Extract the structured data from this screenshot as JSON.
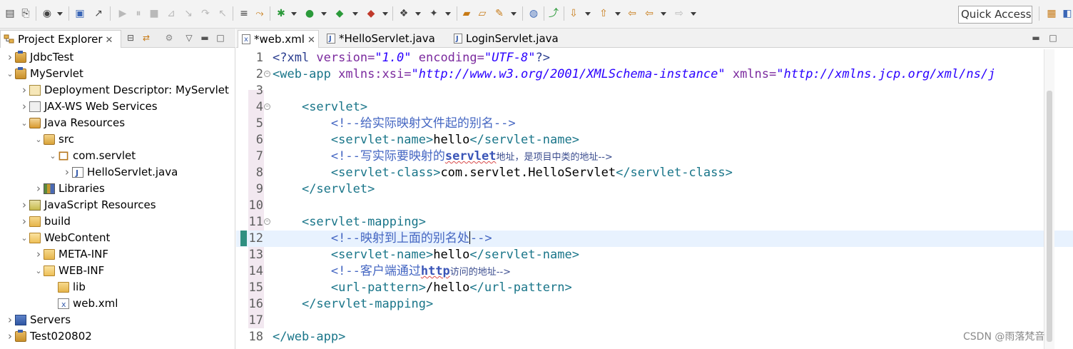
{
  "toolbar": {
    "quick_access": "Quick Access",
    "icons": [
      "new-icon",
      "open-icon",
      "run-config-icon",
      "console-icon",
      "breakpoint-icon",
      "resume-icon",
      "suspend-icon",
      "terminate-icon",
      "step-into-icon",
      "step-over-icon",
      "step-return-icon",
      "organize-icon",
      "debug-icon",
      "run-icon",
      "coverage-icon",
      "external-tools-icon",
      "new-server-icon",
      "open-type-icon",
      "search-icon",
      "back-icon",
      "forward-icon",
      "perspective-icon"
    ]
  },
  "explorer": {
    "title": "Project Explorer",
    "items": [
      {
        "label": "JdbcTest",
        "depth": 0,
        "expanded": false,
        "icon": "project-icon"
      },
      {
        "label": "MyServlet",
        "depth": 0,
        "expanded": true,
        "icon": "project-icon"
      },
      {
        "label": "Deployment Descriptor: MyServlet",
        "depth": 1,
        "expanded": false,
        "icon": "descriptor-icon"
      },
      {
        "label": "JAX-WS Web Services",
        "depth": 1,
        "expanded": false,
        "icon": "webservice-icon"
      },
      {
        "label": "Java Resources",
        "depth": 1,
        "expanded": true,
        "icon": "java-resources-icon"
      },
      {
        "label": "src",
        "depth": 2,
        "expanded": true,
        "icon": "source-folder-icon"
      },
      {
        "label": "com.servlet",
        "depth": 3,
        "expanded": true,
        "icon": "package-icon"
      },
      {
        "label": "HelloServlet.java",
        "depth": 4,
        "expanded": false,
        "icon": "java-file-icon"
      },
      {
        "label": "Libraries",
        "depth": 2,
        "expanded": false,
        "icon": "library-icon"
      },
      {
        "label": "JavaScript Resources",
        "depth": 1,
        "expanded": false,
        "icon": "javascript-icon"
      },
      {
        "label": "build",
        "depth": 1,
        "expanded": false,
        "icon": "folder-icon"
      },
      {
        "label": "WebContent",
        "depth": 1,
        "expanded": true,
        "icon": "open-folder-icon"
      },
      {
        "label": "META-INF",
        "depth": 2,
        "expanded": false,
        "icon": "folder-icon"
      },
      {
        "label": "WEB-INF",
        "depth": 2,
        "expanded": true,
        "icon": "open-folder-icon"
      },
      {
        "label": "lib",
        "depth": 3,
        "leaf": true,
        "icon": "folder-icon"
      },
      {
        "label": "web.xml",
        "depth": 3,
        "leaf": true,
        "icon": "xml-file-icon"
      },
      {
        "label": "Servers",
        "depth": 0,
        "expanded": false,
        "icon": "servers-icon"
      },
      {
        "label": "Test020802",
        "depth": 0,
        "expanded": false,
        "icon": "project-icon"
      }
    ]
  },
  "editor": {
    "tabs": [
      {
        "label": "*web.xml",
        "active": true,
        "closable": true
      },
      {
        "label": "*HelloServlet.java",
        "active": false
      },
      {
        "label": "LoginServlet.java",
        "active": false
      }
    ],
    "current_line": 12,
    "lines": [
      {
        "n": "1",
        "t": "<?xml version=\"1.0\" encoding=\"UTF-8\"?>"
      },
      {
        "n": "2",
        "t": "<web-app xmlns:xsi=\"http://www.w3.org/2001/XMLSchema-instance\" xmlns=\"http://xmlns.jcp.org/xml/ns/j"
      },
      {
        "n": "3",
        "t": ""
      },
      {
        "n": "4",
        "t": "    <servlet>"
      },
      {
        "n": "5",
        "t": "        <!--给实际映射文件起的别名-->"
      },
      {
        "n": "6",
        "t": "        <servlet-name>hello</servlet-name>"
      },
      {
        "n": "7",
        "t": "        <!--写实际要映射的servlet地址，是项目中类的地址-->"
      },
      {
        "n": "8",
        "t": "        <servlet-class>com.servlet.HelloServlet</servlet-class>"
      },
      {
        "n": "9",
        "t": "    </servlet>"
      },
      {
        "n": "10",
        "t": ""
      },
      {
        "n": "11",
        "t": "    <servlet-mapping>"
      },
      {
        "n": "12",
        "t": "        <!--映射到上面的别名处-->"
      },
      {
        "n": "13",
        "t": "        <servlet-name>hello</servlet-name>"
      },
      {
        "n": "14",
        "t": "        <!--客户端通过http访问的地址-->"
      },
      {
        "n": "15",
        "t": "        <url-pattern>/hello</url-pattern>"
      },
      {
        "n": "16",
        "t": "    </servlet-mapping>"
      },
      {
        "n": "17",
        "t": ""
      },
      {
        "n": "18",
        "t": "</web-app>"
      }
    ]
  },
  "watermark": "CSDN @雨落梵音",
  "colors": {
    "tag": "#197589",
    "attr": "#7b2a9e",
    "value": "#2a00ff",
    "comment": "#4466c2",
    "current_line": "#e8f2fe"
  }
}
